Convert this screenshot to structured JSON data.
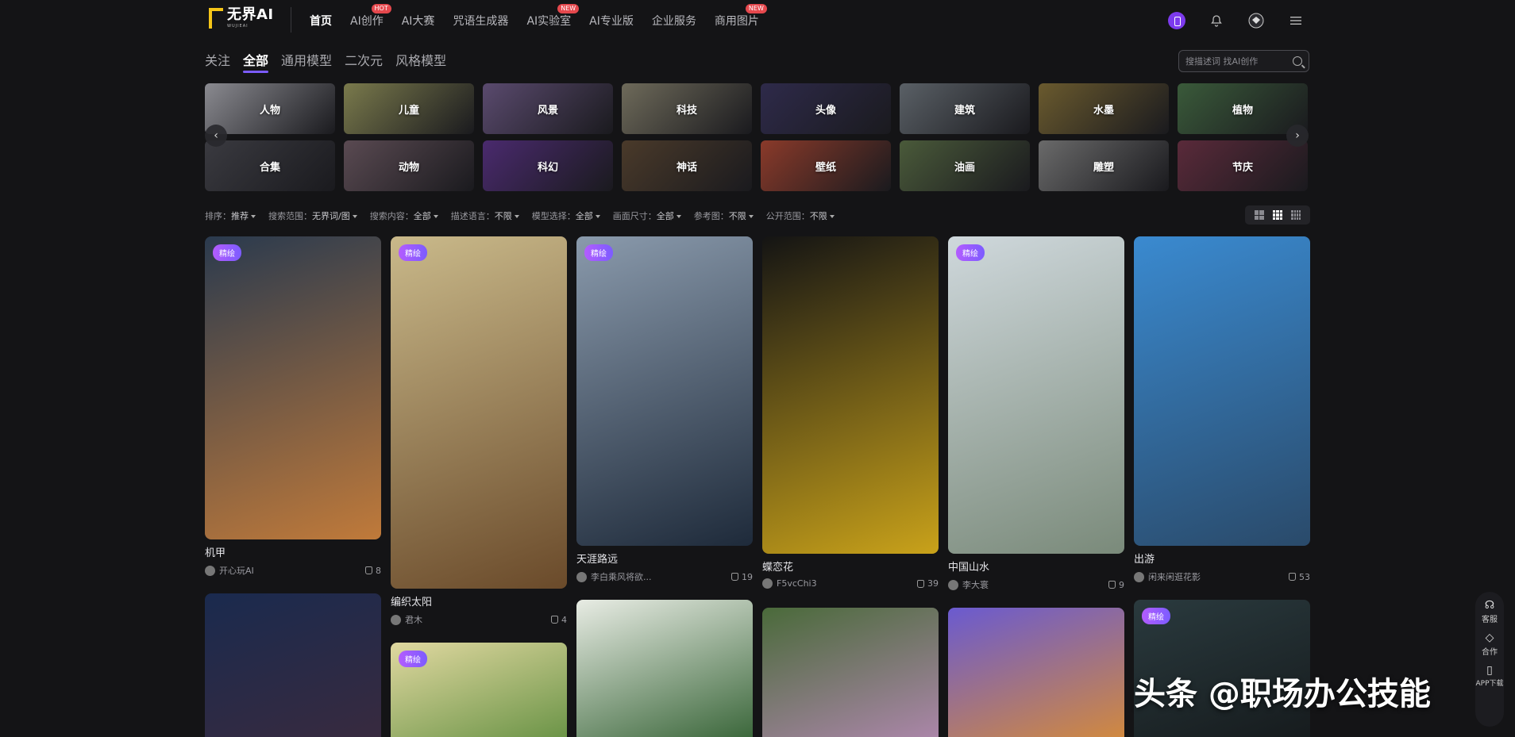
{
  "logo": {
    "name": "无界AI",
    "sub": "WUJIEAI"
  },
  "nav": [
    {
      "label": "首页",
      "badge": ""
    },
    {
      "label": "AI创作",
      "badge": "HOT"
    },
    {
      "label": "AI大赛",
      "badge": ""
    },
    {
      "label": "咒语生成器",
      "badge": ""
    },
    {
      "label": "AI实验室",
      "badge": "NEW"
    },
    {
      "label": "AI专业版",
      "badge": ""
    },
    {
      "label": "企业服务",
      "badge": ""
    },
    {
      "label": "商用图片",
      "badge": "NEW"
    }
  ],
  "tabs": [
    "关注",
    "全部",
    "通用模型",
    "二次元",
    "风格模型"
  ],
  "search": {
    "placeholder": "搜描述词 找AI创作"
  },
  "categories": [
    {
      "label": "人物",
      "color": "#8a8a90"
    },
    {
      "label": "儿童",
      "color": "#7a7a4c"
    },
    {
      "label": "风景",
      "color": "#5a4a6e"
    },
    {
      "label": "科技",
      "color": "#6e6a5a"
    },
    {
      "label": "头像",
      "color": "#2e2a4a"
    },
    {
      "label": "建筑",
      "color": "#5a6066"
    },
    {
      "label": "水墨",
      "color": "#6a5a2e"
    },
    {
      "label": "植物",
      "color": "#3a5a3a"
    },
    {
      "label": "合集",
      "color": "#3a3a40"
    },
    {
      "label": "动物",
      "color": "#5a4a52"
    },
    {
      "label": "科幻",
      "color": "#4a2a6e"
    },
    {
      "label": "神话",
      "color": "#4a3a2a"
    },
    {
      "label": "壁纸",
      "color": "#8a3a2a"
    },
    {
      "label": "油画",
      "color": "#4a5a3a"
    },
    {
      "label": "雕塑",
      "color": "#6a6a6a"
    },
    {
      "label": "节庆",
      "color": "#5a2a3a"
    }
  ],
  "filters": [
    {
      "label": "排序：",
      "value": "推荐"
    },
    {
      "label": "搜索范围：",
      "value": "无界词/图"
    },
    {
      "label": "搜索内容：",
      "value": "全部"
    },
    {
      "label": "描述语言：",
      "value": "不限"
    },
    {
      "label": "模型选择：",
      "value": "全部"
    },
    {
      "label": "画面尺寸：",
      "value": "全部"
    },
    {
      "label": "参考图：",
      "value": "不限"
    },
    {
      "label": "公开范围：",
      "value": "不限"
    }
  ],
  "cards": [
    {
      "title": "机甲",
      "author": "开心玩AI",
      "likes": "8",
      "tag": "精绘",
      "c1": "#2a3a4e",
      "c2": "#c07a3a"
    },
    {
      "title": "编织太阳",
      "author": "君木",
      "likes": "4",
      "tag": "精绘",
      "c1": "#c9b98a",
      "c2": "#6a4a2a"
    },
    {
      "title": "天涯路远",
      "author": "李白乘风将欲...",
      "likes": "19",
      "tag": "精绘",
      "c1": "#8a9aac",
      "c2": "#1e2a3a"
    },
    {
      "title": "蝶恋花",
      "author": "F5vcChi3",
      "likes": "39",
      "tag": "",
      "c1": "#141414",
      "c2": "#c9a21a"
    },
    {
      "title": "中国山水",
      "author": "李大寰",
      "likes": "9",
      "tag": "精绘",
      "c1": "#cfd8dc",
      "c2": "#7a8a7a"
    },
    {
      "title": "出游",
      "author": "闲来闲逛花影",
      "likes": "53",
      "tag": "",
      "c1": "#3a8ad0",
      "c2": "#2a4a6a"
    },
    {
      "title": "",
      "author": "",
      "likes": "",
      "tag": "",
      "c1": "#1a2a4e",
      "c2": "#3a2a3e"
    },
    {
      "title": "",
      "author": "",
      "likes": "",
      "tag": "精绘",
      "c1": "#e0d8a0",
      "c2": "#5a8a3a"
    },
    {
      "title": "",
      "author": "",
      "likes": "",
      "tag": "",
      "c1": "#e8ece4",
      "c2": "#2a5a2a"
    },
    {
      "title": "",
      "author": "",
      "likes": "",
      "tag": "",
      "c1": "#4a6a3a",
      "c2": "#b98ab9"
    },
    {
      "title": "",
      "author": "",
      "likes": "",
      "tag": "",
      "c1": "#6a5ad0",
      "c2": "#e0902a"
    },
    {
      "title": "",
      "author": "",
      "likes": "",
      "tag": "精绘",
      "c1": "#2a3a3e",
      "c2": "#14181a"
    }
  ],
  "side": [
    {
      "label": "客服",
      "icon": "headset-icon"
    },
    {
      "label": "合作",
      "icon": "handshake-icon"
    },
    {
      "label": "APP下载",
      "icon": "phone-icon"
    }
  ],
  "watermark": "头条 @职场办公技能"
}
